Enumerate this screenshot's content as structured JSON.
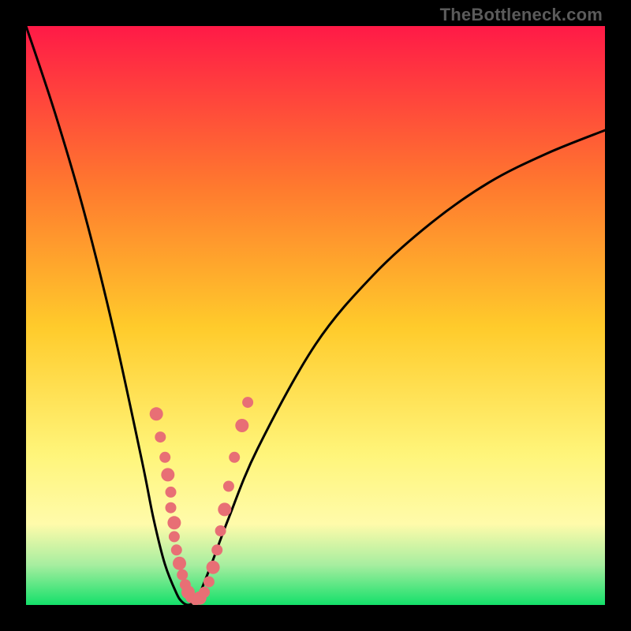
{
  "watermark": "TheBottleneck.com",
  "colors": {
    "frame": "#000000",
    "grad_top": "#ff1a47",
    "grad_mid1": "#ff7a2e",
    "grad_mid2": "#ffcb2b",
    "grad_yellow": "#fff57a",
    "grad_paleyellow": "#fffbaa",
    "grad_lightgreen": "#a8eea0",
    "grad_green": "#14e06a",
    "curve": "#000000",
    "dot": "#e86f75",
    "watermark": "#5b5b5b"
  },
  "chart_data": {
    "type": "line",
    "title": "",
    "xlabel": "",
    "ylabel": "",
    "xlim": [
      0,
      100
    ],
    "ylim": [
      0,
      100
    ],
    "x_optimum_fraction": 0.28,
    "series": [
      {
        "name": "bottleneck-curve",
        "x": [
          0,
          5,
          10,
          15,
          20,
          22,
          24,
          26,
          27,
          28,
          29,
          30,
          32,
          35,
          40,
          50,
          60,
          70,
          80,
          90,
          100
        ],
        "y": [
          100,
          85,
          68,
          48,
          25,
          15,
          7,
          2,
          0.5,
          0,
          0.5,
          2,
          7,
          15,
          27,
          45,
          57,
          66,
          73,
          78,
          82
        ]
      }
    ],
    "annotations": {
      "dots_fraction_xy": [
        [
          0.225,
          0.33
        ],
        [
          0.232,
          0.29
        ],
        [
          0.24,
          0.255
        ],
        [
          0.245,
          0.225
        ],
        [
          0.25,
          0.195
        ],
        [
          0.25,
          0.168
        ],
        [
          0.256,
          0.142
        ],
        [
          0.256,
          0.118
        ],
        [
          0.26,
          0.095
        ],
        [
          0.265,
          0.072
        ],
        [
          0.27,
          0.052
        ],
        [
          0.275,
          0.035
        ],
        [
          0.28,
          0.022
        ],
        [
          0.285,
          0.013
        ],
        [
          0.293,
          0.009
        ],
        [
          0.3,
          0.012
        ],
        [
          0.308,
          0.022
        ],
        [
          0.316,
          0.04
        ],
        [
          0.323,
          0.065
        ],
        [
          0.33,
          0.095
        ],
        [
          0.336,
          0.128
        ],
        [
          0.343,
          0.165
        ],
        [
          0.35,
          0.205
        ],
        [
          0.36,
          0.255
        ],
        [
          0.373,
          0.31
        ],
        [
          0.383,
          0.35
        ]
      ]
    }
  }
}
